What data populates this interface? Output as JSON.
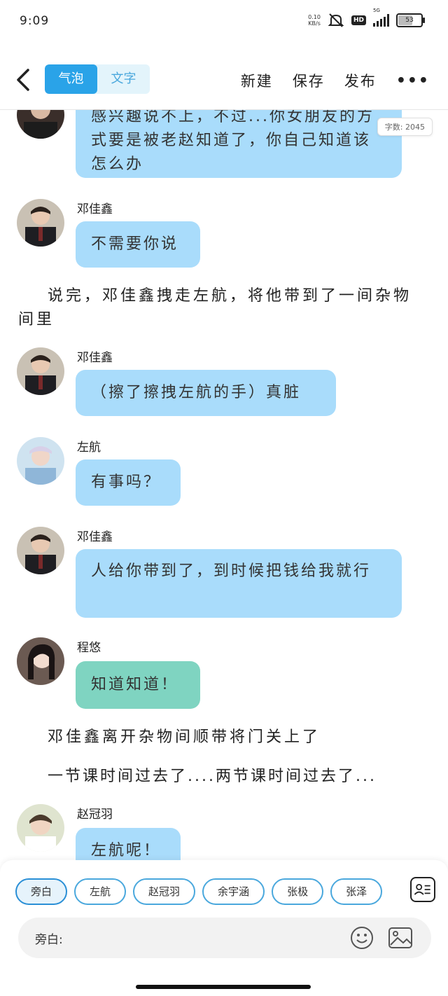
{
  "status": {
    "time": "9:09",
    "net_speed_top": "0.10",
    "net_speed_bottom": "KB/s",
    "hd": "HD",
    "network": "5G",
    "battery": "53"
  },
  "header": {
    "modes": [
      "气泡",
      "文字"
    ],
    "actions": {
      "new": "新建",
      "save": "保存",
      "publish": "发布"
    },
    "more": "•••"
  },
  "word_count": "字数: 2045",
  "messages": [
    {
      "type": "bubble",
      "speaker": "",
      "text": "感兴趣说不上，不过...你女朋友的方式要是被老赵知道了，你自己知道该怎么办",
      "color": "blue",
      "avatar": "deng"
    },
    {
      "type": "bubble",
      "speaker": "邓佳鑫",
      "text": "不需要你说",
      "color": "blue",
      "avatar": "deng"
    },
    {
      "type": "narration",
      "text": "说完，邓佳鑫拽走左航，将他带到了一间杂物间里"
    },
    {
      "type": "bubble",
      "speaker": "邓佳鑫",
      "text": "（擦了擦拽左航的手）真脏",
      "color": "blue",
      "avatar": "deng"
    },
    {
      "type": "bubble",
      "speaker": "左航",
      "text": "有事吗？",
      "color": "blue",
      "avatar": "zuo"
    },
    {
      "type": "bubble",
      "speaker": "邓佳鑫",
      "text": "人给你带到了，到时候把钱给我就行",
      "color": "blue",
      "avatar": "deng"
    },
    {
      "type": "bubble",
      "speaker": "程悠",
      "text": "知道知道！",
      "color": "green",
      "avatar": "cheng"
    },
    {
      "type": "narration",
      "text": "邓佳鑫离开杂物间顺带将门关上了"
    },
    {
      "type": "narration",
      "text": "一节课时间过去了....两节课时间过去了..."
    },
    {
      "type": "bubble",
      "speaker": "赵冠羽",
      "text": "左航呢！",
      "color": "blue",
      "avatar": "zhao"
    }
  ],
  "composer": {
    "roles": [
      "旁白",
      "左航",
      "赵冠羽",
      "余宇涵",
      "张极",
      "张泽"
    ],
    "input_label": "旁白:"
  }
}
